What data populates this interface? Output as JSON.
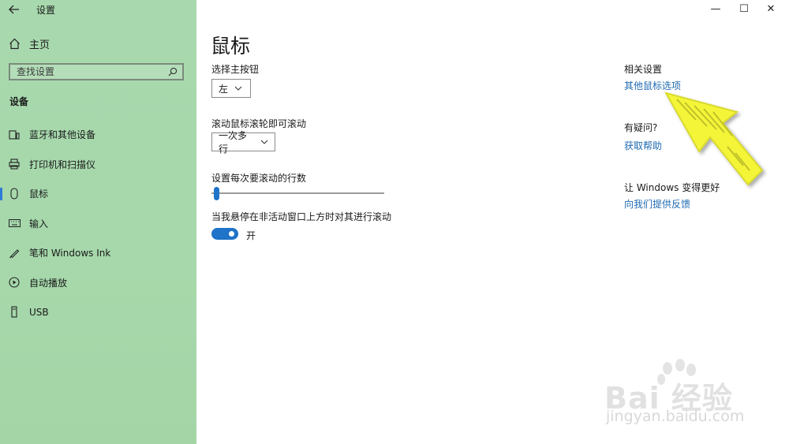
{
  "window": {
    "app_title": "设置",
    "controls": {
      "minimize": "—",
      "maximize": "☐",
      "close": "✕"
    }
  },
  "sidebar": {
    "home_label": "主页",
    "search_placeholder": "查找设置",
    "section_title": "设备",
    "items": [
      {
        "label": "蓝牙和其他设备",
        "icon": "devices-icon"
      },
      {
        "label": "打印机和扫描仪",
        "icon": "printer-icon"
      },
      {
        "label": "鼠标",
        "icon": "mouse-icon",
        "active": true
      },
      {
        "label": "输入",
        "icon": "keyboard-icon"
      },
      {
        "label": "笔和 Windows Ink",
        "icon": "pen-icon"
      },
      {
        "label": "自动播放",
        "icon": "autoplay-icon"
      },
      {
        "label": "USB",
        "icon": "usb-icon"
      }
    ]
  },
  "main": {
    "title": "鼠标",
    "primary_button_label": "选择主按钮",
    "primary_button_value": "左",
    "scroll_label": "滚动鼠标滚轮即可滚动",
    "scroll_value": "一次多行",
    "lines_label": "设置每次要滚动的行数",
    "lines_slider_value": 0.02,
    "inactive_scroll_label": "当我悬停在非活动窗口上方时对其进行滚动",
    "inactive_scroll_state": "开",
    "inactive_scroll_on": true
  },
  "related": {
    "heading": "相关设置",
    "link": "其他鼠标选项",
    "help_heading": "有疑问?",
    "help_link": "获取帮助",
    "feedback_heading": "让 Windows 变得更好",
    "feedback_link": "向我们提供反馈"
  },
  "watermark": {
    "brand": "Bai 经验",
    "url": "jingyan.baidu.com"
  },
  "colors": {
    "sidebar_bg": "#a6d8ab",
    "accent": "#1f73c8",
    "link": "#1f6ab0",
    "arrow_fill": "#f4f538"
  }
}
